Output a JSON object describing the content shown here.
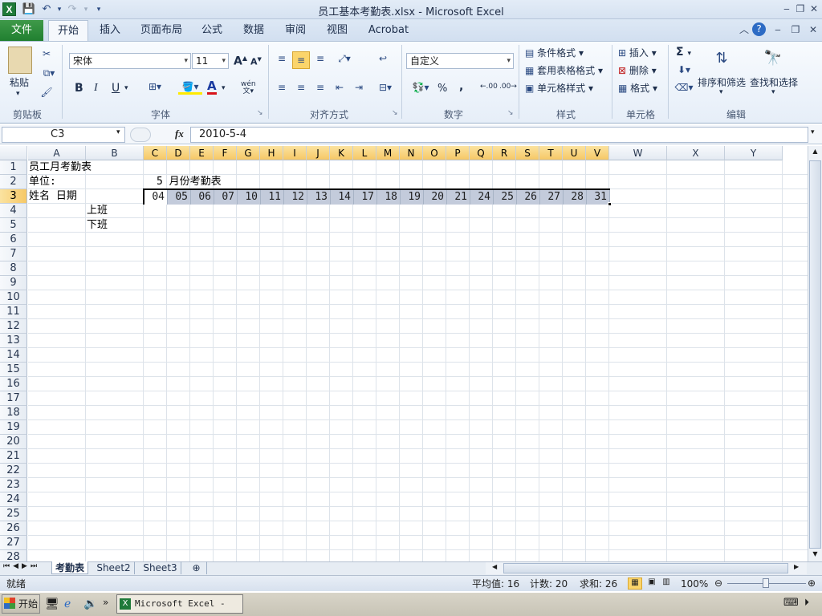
{
  "window": {
    "title": "员工基本考勤表.xlsx  -  Microsoft Excel",
    "app_letter": "X"
  },
  "quick_access": {
    "save": "💾",
    "undo": "↶",
    "redo": "↷",
    "more": "▾"
  },
  "tabs": {
    "file": "文件",
    "items": [
      "开始",
      "插入",
      "页面布局",
      "公式",
      "数据",
      "审阅",
      "视图",
      "Acrobat"
    ]
  },
  "ribbon": {
    "clipboard": {
      "paste": "粘贴",
      "label": "剪贴板"
    },
    "font": {
      "name": "宋体",
      "size": "11",
      "label": "字体",
      "bold": "B",
      "italic": "I",
      "underline": "U",
      "grow": "A",
      "shrink": "A",
      "color": "A",
      "phonetic": "wén"
    },
    "alignment": {
      "label": "对齐方式"
    },
    "number": {
      "format": "自定义",
      "label": "数字",
      "percent": "%",
      "comma": ",",
      "inc": ".00",
      "dec": ".00"
    },
    "styles": {
      "conditional": "条件格式",
      "table": "套用表格格式",
      "cell": "单元格样式",
      "label": "样式"
    },
    "cells": {
      "insert": "插入",
      "delete": "删除",
      "format": "格式",
      "label": "单元格"
    },
    "editing": {
      "sum": "Σ",
      "sort": "排序和筛选",
      "find": "查找和选择",
      "label": "编辑"
    }
  },
  "formula_bar": {
    "name_box": "C3",
    "fx": "fx",
    "content": "2010-5-4"
  },
  "columns": [
    "A",
    "B",
    "C",
    "D",
    "E",
    "F",
    "G",
    "H",
    "I",
    "J",
    "K",
    "L",
    "M",
    "N",
    "O",
    "P",
    "Q",
    "R",
    "S",
    "T",
    "U",
    "V",
    "W",
    "X",
    "Y"
  ],
  "rows": [
    "1",
    "2",
    "3",
    "4",
    "5",
    "6",
    "7",
    "8",
    "9",
    "10",
    "11",
    "12",
    "13",
    "14",
    "15",
    "16",
    "17",
    "18",
    "19",
    "20",
    "21",
    "22",
    "23",
    "24",
    "25",
    "26",
    "27",
    "28"
  ],
  "cells": {
    "a1": "员工月考勤表",
    "a2": "单位:",
    "month": "5 月份考勤表",
    "a3": "姓名   日期",
    "b4": "上班",
    "b5": "下班",
    "dates": [
      "04",
      "05",
      "06",
      "07",
      "10",
      "11",
      "12",
      "13",
      "14",
      "17",
      "18",
      "19",
      "20",
      "21",
      "24",
      "25",
      "26",
      "27",
      "28",
      "31"
    ]
  },
  "sheets": [
    "考勤表",
    "Sheet2",
    "Sheet3"
  ],
  "status": {
    "ready": "就绪",
    "average": "平均值: 16",
    "count": "计数: 20",
    "sum": "求和: 26",
    "zoom": "100%"
  },
  "taskbar": {
    "start": "开始",
    "item": "Microsoft Excel - ..."
  }
}
